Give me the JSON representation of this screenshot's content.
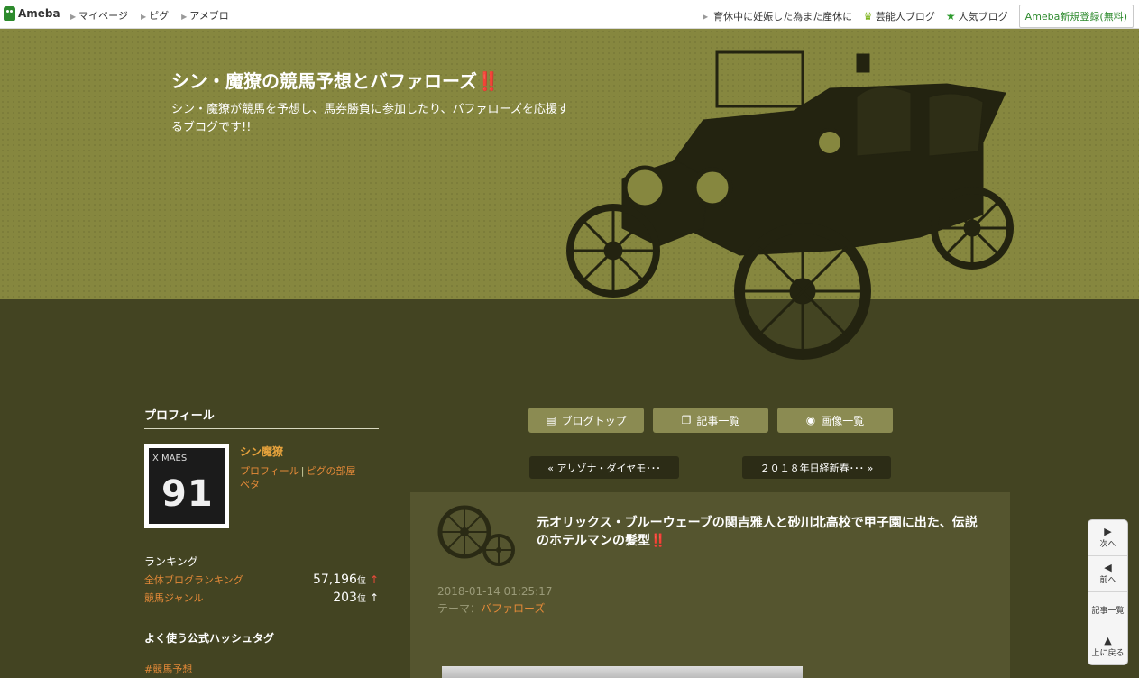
{
  "topbar": {
    "logo": "Ameba",
    "nav": [
      "マイページ",
      "ピグ",
      "アメブロ"
    ],
    "news": "育休中に妊娠した為また産休に",
    "celeb_blog": "芸能人ブログ",
    "popular_blog": "人気ブログ",
    "register": "Ameba新規登録(無料)"
  },
  "header": {
    "title": "シン・魔獠の競馬予想とバファローズ",
    "title_mark": "‼️",
    "description": "シン・魔獠が競馬を予想し、馬券勝負に参加したり、バファローズを応援するブログです!!"
  },
  "sidebar": {
    "profile_heading": "プロフィール",
    "name": "シン魔獠",
    "links": [
      "プロフィール",
      "ピグの部屋",
      "ペタ"
    ],
    "avatar_text": "X MAES",
    "avatar_number": "91",
    "ranking_title": "ランキング",
    "rankings": [
      {
        "label": "全体ブログランキング",
        "value": "57,196",
        "unit": "位",
        "arrow": "↑"
      },
      {
        "label": "競馬ジャンル",
        "value": "203",
        "unit": "位",
        "arrow": "↑"
      }
    ],
    "hashtag_heading": "よく使う公式ハッシュタグ",
    "hashtags": [
      "#競馬予想"
    ]
  },
  "nav_buttons": [
    {
      "label": "ブログトップ",
      "icon": "document-icon"
    },
    {
      "label": "記事一覧",
      "icon": "copy-icon"
    },
    {
      "label": "画像一覧",
      "icon": "camera-icon"
    }
  ],
  "pager": {
    "prev": "« アリゾナ・ダイヤモ･･･",
    "next": "２０１８年日経新春･･･ »"
  },
  "article": {
    "title": "元オリックス・ブルーウェーブの関吉雅人と砂川北高校で甲子園に出た、伝説のホテルマンの髪型",
    "title_mark": "‼️",
    "date": "2018-01-14 01:25:17",
    "theme_label": "テーマ：",
    "theme": "バファローズ"
  },
  "floatnav": {
    "next": "次へ",
    "prev": "前へ",
    "list": "記事一覧",
    "top": "上に戻る"
  },
  "colors": {
    "header_bg": "#86873f",
    "body_bg": "#434422",
    "link": "#e58a38",
    "button": "#8b8b52"
  }
}
